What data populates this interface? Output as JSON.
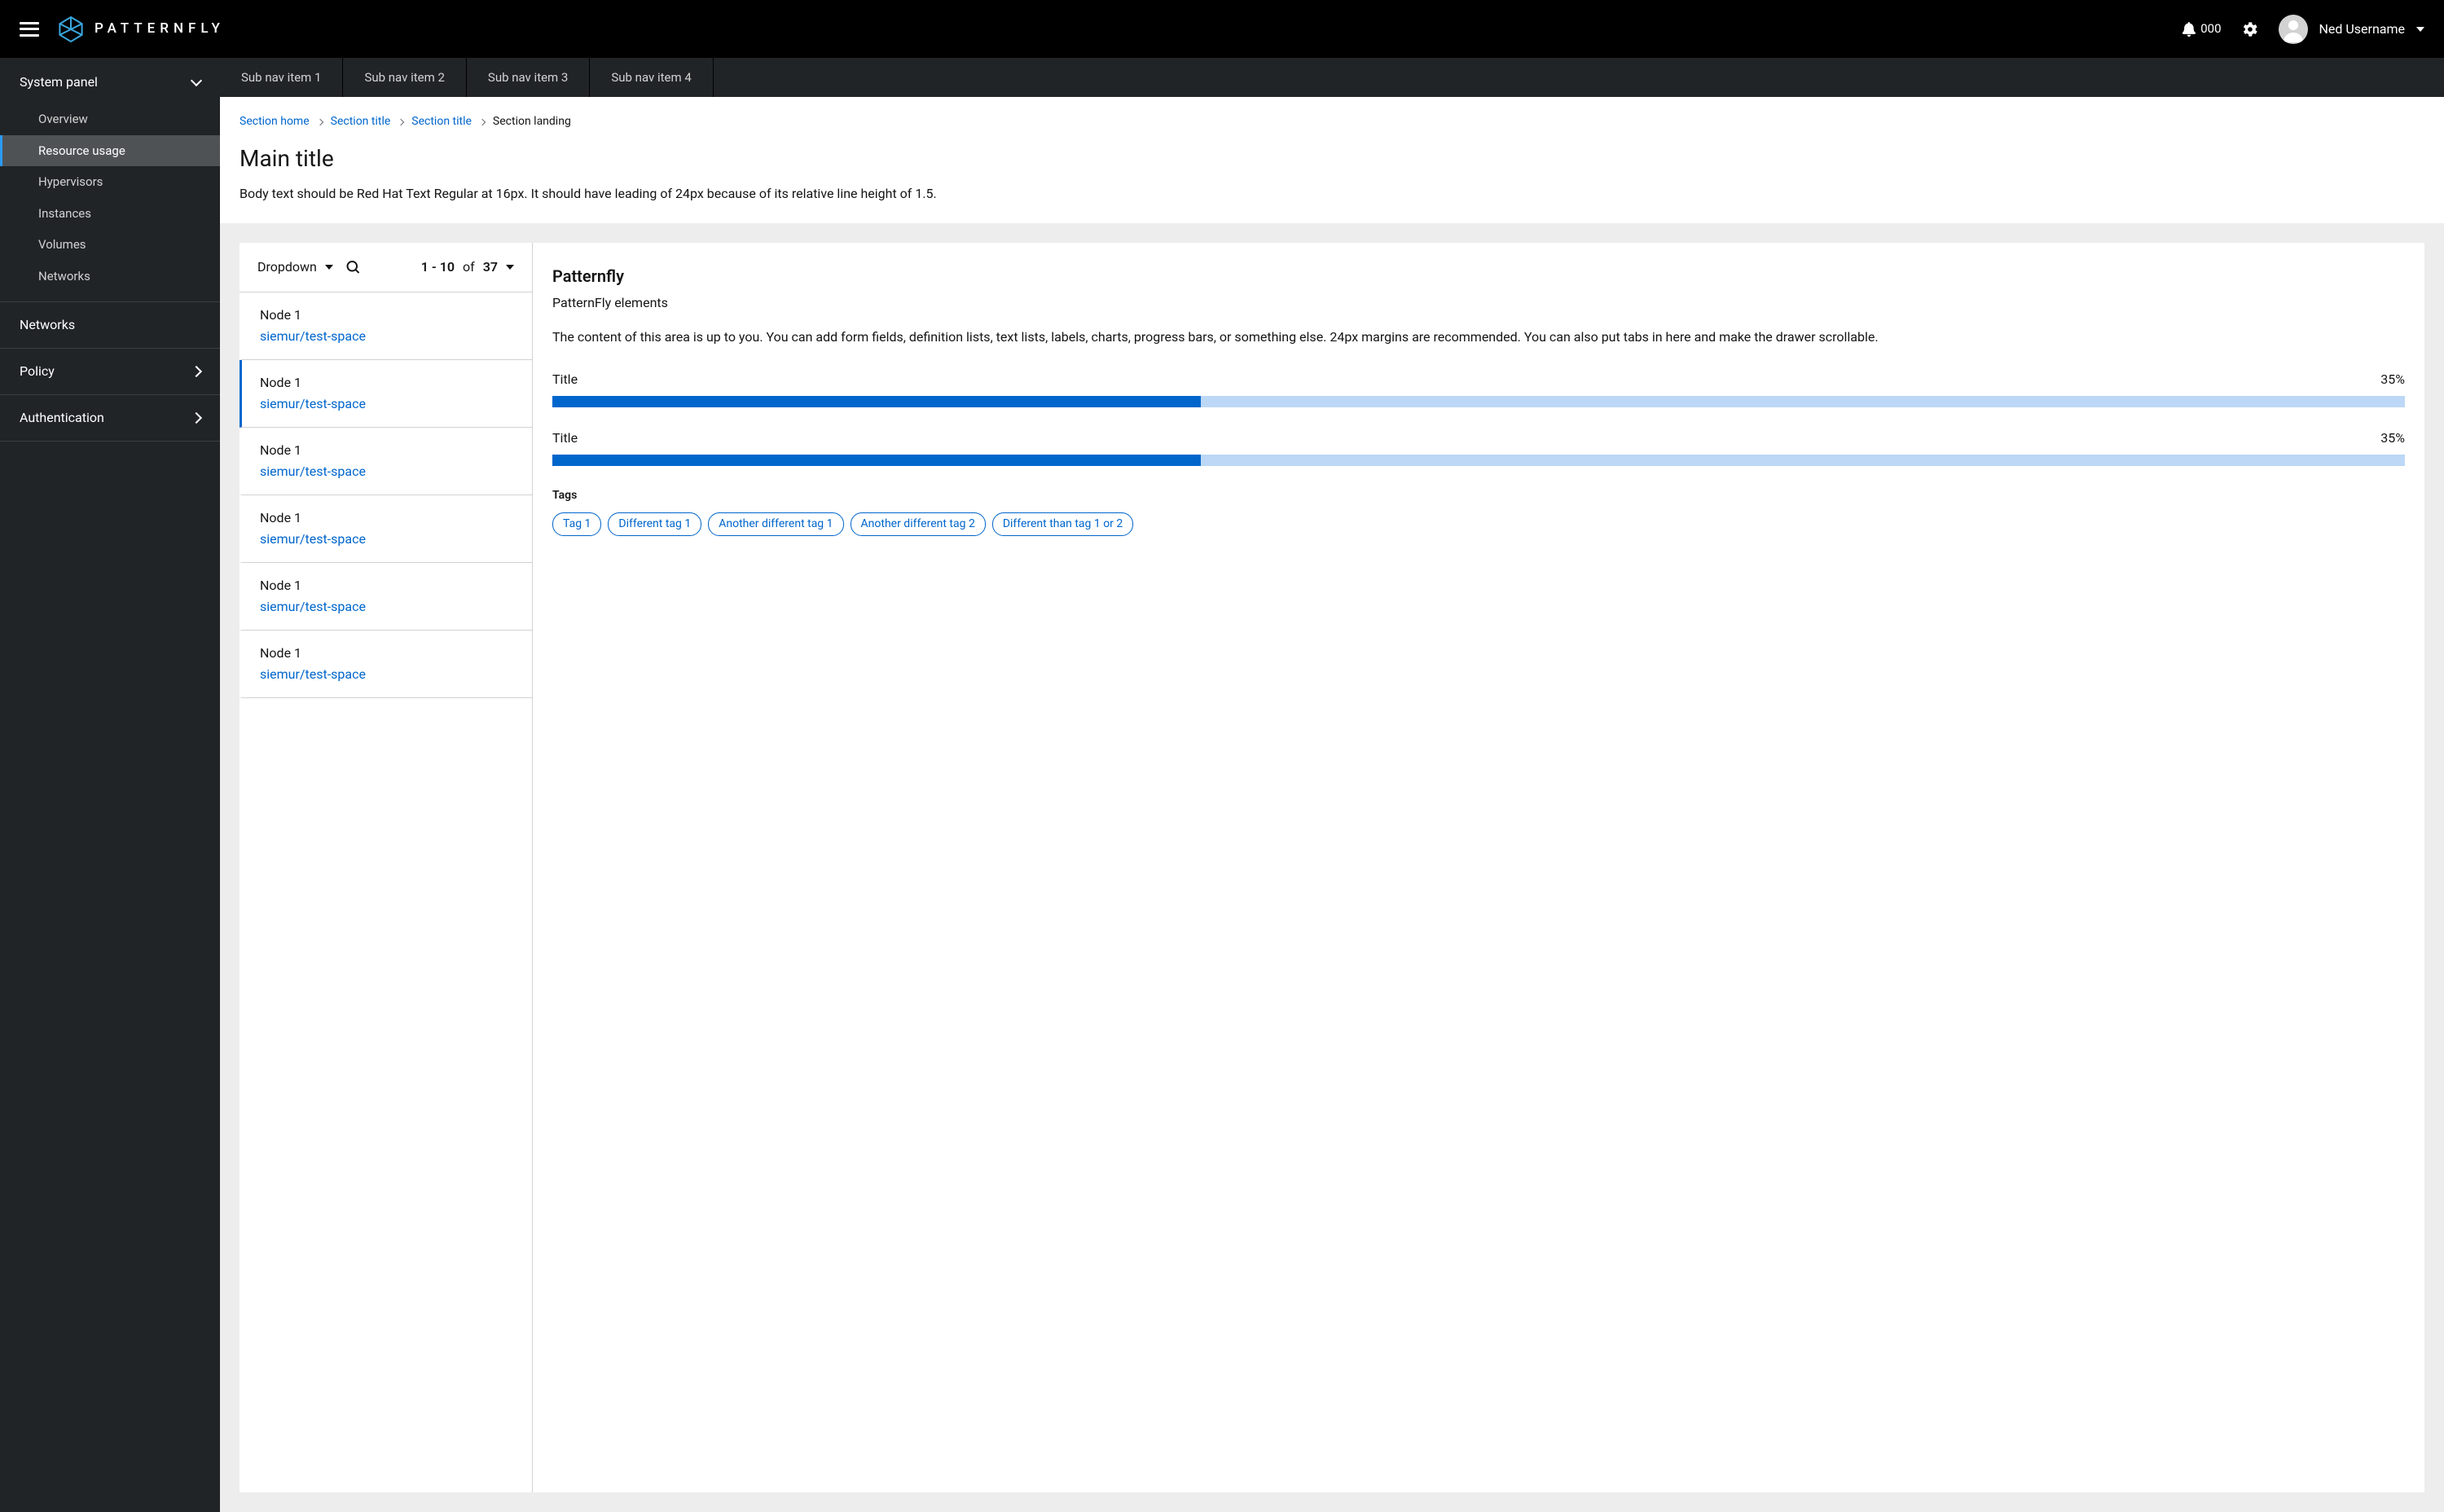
{
  "topbar": {
    "brand_text": "PATTERNFLY",
    "notification_count": "000",
    "user_name": "Ned Username"
  },
  "sidebar": {
    "sections": [
      {
        "label": "System panel",
        "expanded": true,
        "items": [
          {
            "label": "Overview",
            "active": false
          },
          {
            "label": "Resource usage",
            "active": true
          },
          {
            "label": "Hypervisors",
            "active": false
          },
          {
            "label": "Instances",
            "active": false
          },
          {
            "label": "Volumes",
            "active": false
          },
          {
            "label": "Networks",
            "active": false
          }
        ]
      },
      {
        "label": "Networks",
        "expanded": false,
        "items": []
      },
      {
        "label": "Policy",
        "expanded": false,
        "items": []
      },
      {
        "label": "Authentication",
        "expanded": false,
        "items": []
      }
    ]
  },
  "subnav": [
    "Sub nav item 1",
    "Sub nav item 2",
    "Sub nav item 3",
    "Sub nav item 4"
  ],
  "breadcrumb": [
    {
      "label": "Section home",
      "link": true
    },
    {
      "label": "Section title",
      "link": true
    },
    {
      "label": "Section title",
      "link": true
    },
    {
      "label": "Section landing",
      "link": false
    }
  ],
  "page": {
    "title": "Main title",
    "body": "Body text should be Red Hat Text Regular at 16px. It should have leading of 24px because of its relative line height of 1.5."
  },
  "list": {
    "dropdown_label": "Dropdown",
    "pager_range": "1 - 10",
    "pager_of": "of",
    "pager_total": "37",
    "items": [
      {
        "title": "Node 1",
        "sub": "siemur/test-space",
        "selected": false
      },
      {
        "title": "Node 1",
        "sub": "siemur/test-space",
        "selected": true
      },
      {
        "title": "Node 1",
        "sub": "siemur/test-space",
        "selected": false
      },
      {
        "title": "Node 1",
        "sub": "siemur/test-space",
        "selected": false
      },
      {
        "title": "Node 1",
        "sub": "siemur/test-space",
        "selected": false
      },
      {
        "title": "Node 1",
        "sub": "siemur/test-space",
        "selected": false
      }
    ]
  },
  "detail": {
    "title": "Patternfly",
    "subtitle": "PatternFly elements",
    "description": "The content of this area is up to you. You can add form fields, definition lists, text lists, labels, charts, progress bars, or something else. 24px margins are recommended. You can also put tabs in here and make the drawer scrollable.",
    "progress": [
      {
        "label": "Title",
        "percent": 35
      },
      {
        "label": "Title",
        "percent": 35
      }
    ],
    "tags_label": "Tags",
    "tags": [
      "Tag 1",
      "Different tag 1",
      "Another different tag 1",
      "Another different tag 2",
      "Different than tag 1 or 2"
    ]
  }
}
